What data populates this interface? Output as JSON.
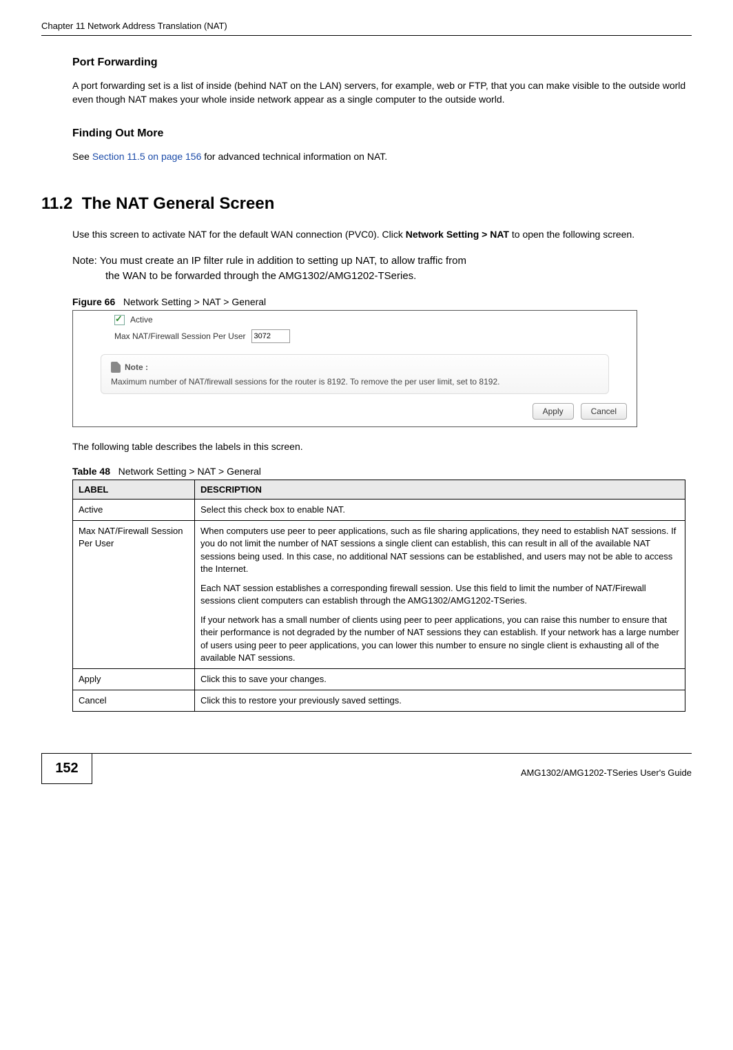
{
  "header": {
    "chapter": "Chapter 11 Network Address Translation (NAT)"
  },
  "s1": {
    "h": "Port Forwarding",
    "p": "A port forwarding set is a list of inside (behind NAT on the LAN) servers, for example, web or FTP, that you can make visible to the outside world even though NAT makes your whole inside network appear as a single computer to the outside world."
  },
  "s2": {
    "h": "Finding Out More",
    "p_pre": "See ",
    "xref": "Section 11.5 on page 156",
    "p_post": " for advanced technical information on NAT."
  },
  "sec": {
    "num": "11.2",
    "title": "The NAT General Screen",
    "intro_a": "Use this screen to activate NAT for the default WAN connection (PVC0). Click ",
    "intro_bold": "Network Setting > NAT",
    "intro_b": " to open the following screen.",
    "note_lead": "Note: ",
    "note_l1": "You must create an IP filter rule in addition to setting up NAT, to allow traffic from",
    "note_l2": "the WAN to be forwarded through the AMG1302/AMG1202-TSeries."
  },
  "fig": {
    "label": "Figure 66",
    "caption": "Network Setting > NAT > General",
    "active_label": "Active",
    "session_label": "Max NAT/Firewall Session Per User",
    "session_value": "3072",
    "note_head": "Note :",
    "note_text": "Maximum number of NAT/firewall sessions for the router is 8192. To remove the per user limit, set to 8192.",
    "btn_apply": "Apply",
    "btn_cancel": "Cancel"
  },
  "after_fig": "The following table describes the labels in this screen.",
  "table": {
    "label": "Table 48",
    "caption": "Network Setting > NAT > General",
    "h1": "LABEL",
    "h2": "DESCRIPTION",
    "rows": [
      {
        "l": "Active",
        "d1": "Select this check box to enable NAT."
      },
      {
        "l": "Max NAT/Firewall Session Per User",
        "d1": "When computers use peer to peer applications, such as file sharing applications, they need to establish NAT sessions. If you do not limit the number of NAT sessions a single client can establish, this can result in all of the available NAT sessions being used. In this case, no additional NAT sessions can be established, and users may not be able to access the Internet.",
        "d2": "Each NAT session establishes a corresponding firewall session. Use this field to limit the number of NAT/Firewall sessions client computers can establish through the AMG1302/AMG1202-TSeries.",
        "d3": "If your network has a small number of clients using peer to peer applications, you can raise this number to ensure that their performance is not degraded by the number of NAT sessions they can establish. If your network has a large number of users using peer to peer applications, you can lower this number to ensure no single client is exhausting all of the available NAT sessions."
      },
      {
        "l": "Apply",
        "d1": "Click this to save your changes."
      },
      {
        "l": "Cancel",
        "d1": "Click this to restore your previously saved settings."
      }
    ]
  },
  "footer": {
    "page": "152",
    "guide": "AMG1302/AMG1202-TSeries User's Guide"
  }
}
